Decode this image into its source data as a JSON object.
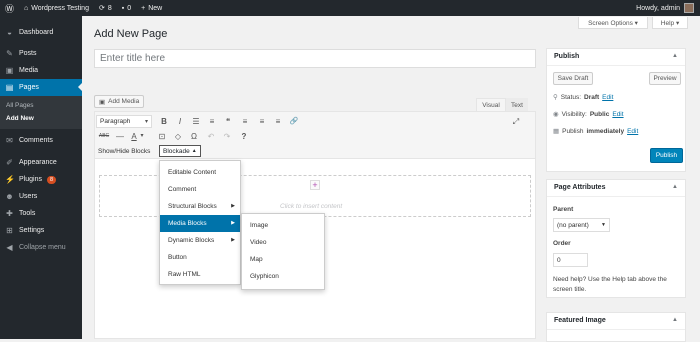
{
  "adminbar": {
    "site": "Wordpress Testing",
    "updates": "8",
    "comments": "0",
    "new": "New",
    "howdy": "Howdy, admin"
  },
  "sidebar": {
    "items": [
      {
        "label": "Dashboard",
        "icon": "◒"
      },
      {
        "label": "Posts",
        "icon": "✎"
      },
      {
        "label": "Media",
        "icon": "▣"
      },
      {
        "label": "Pages",
        "icon": "▤"
      }
    ],
    "sub": [
      "All Pages",
      "Add New"
    ],
    "items2": [
      {
        "label": "Comments",
        "icon": "✉"
      },
      {
        "label": "Appearance",
        "icon": "✐"
      },
      {
        "label": "Plugins",
        "icon": "⚡",
        "badge": "8"
      },
      {
        "label": "Users",
        "icon": "☻"
      },
      {
        "label": "Tools",
        "icon": "✚"
      },
      {
        "label": "Settings",
        "icon": "⊞"
      },
      {
        "label": "Collapse menu",
        "icon": "◀"
      }
    ]
  },
  "screen_options": "Screen Options ▾",
  "help": "Help ▾",
  "page_title": "Add New Page",
  "title_placeholder": "Enter title here",
  "add_media": "Add Media",
  "tabs": {
    "visual": "Visual",
    "text": "Text"
  },
  "editor": {
    "format": "Paragraph",
    "row1": [
      "B",
      "I",
      "☰",
      "≡",
      "❝",
      "≡",
      "≡",
      "≡",
      "🔗"
    ],
    "row2": [
      "ABC",
      "—",
      "A",
      "▾",
      "⊡",
      "◇",
      "Ω",
      "↶",
      "↷",
      "?"
    ],
    "show_hide": "Show/Hide Blocks",
    "blockade": "Blockade",
    "plus": "+",
    "click_insert": "Click to insert content"
  },
  "dropdown": [
    "Editable Content",
    "Comment",
    "Structural Blocks",
    "Media Blocks",
    "Dynamic Blocks",
    "Button",
    "Raw HTML"
  ],
  "media_submenu": [
    "Image",
    "Video",
    "Map",
    "Glyphicon"
  ],
  "publish": {
    "title": "Publish",
    "save_draft": "Save Draft",
    "preview": "Preview",
    "status_label": "Status:",
    "status_value": "Draft",
    "visibility_label": "Visibility:",
    "visibility_value": "Public",
    "publish_label": "Publish",
    "publish_value": "immediately",
    "edit": "Edit",
    "publish_btn": "Publish"
  },
  "page_attributes": {
    "title": "Page Attributes",
    "parent_label": "Parent",
    "parent_value": "(no parent)",
    "order_label": "Order",
    "order_value": "0",
    "help_text": "Need help? Use the Help tab above the screen title."
  },
  "featured_image": {
    "title": "Featured Image"
  }
}
